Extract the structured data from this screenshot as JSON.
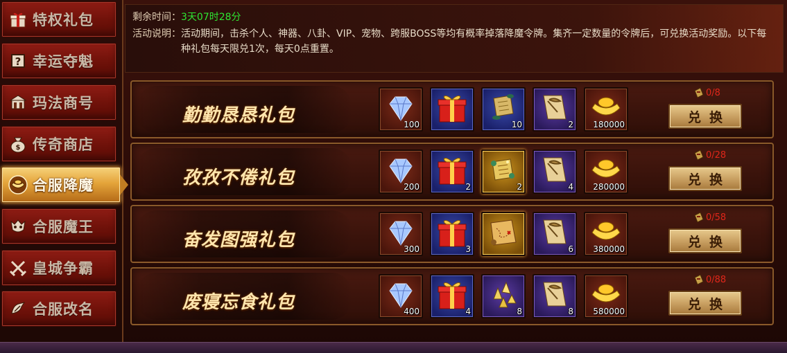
{
  "sidebar": {
    "items": [
      {
        "label": "特权礼包",
        "icon": "gift-box-icon"
      },
      {
        "label": "幸运夺魁",
        "icon": "question-mark-icon"
      },
      {
        "label": "玛法商号",
        "icon": "shop-icon"
      },
      {
        "label": "传奇商店",
        "icon": "money-bag-icon"
      },
      {
        "label": "合服降魔",
        "icon": "ingot-icon",
        "active": true
      },
      {
        "label": "合服魔王",
        "icon": "demon-skull-icon"
      },
      {
        "label": "皇城争霸",
        "icon": "crossed-swords-icon"
      },
      {
        "label": "合服改名",
        "icon": "rename-icon"
      }
    ]
  },
  "info": {
    "time_label": "剩余时间：",
    "time_value": "3天07时28分",
    "desc_label": "活动说明：",
    "desc_text": "活动期间，击杀个人、神器、八卦、VIP、宠物、跨服BOSS等均有概率掉落降魔令牌。集齐一定数量的令牌后，可兑换活动奖励。以下每种礼包每天限兑1次，每天0点重置。"
  },
  "gifts": [
    {
      "title": "勤勤恳恳礼包",
      "items": [
        {
          "icon": "diamond-icon",
          "count": "100"
        },
        {
          "icon": "red-gift-box-icon",
          "count": ""
        },
        {
          "icon": "scroll-icon",
          "count": "10"
        },
        {
          "icon": "pickaxe-scroll-icon",
          "count": "2"
        },
        {
          "icon": "gold-ingot-icon",
          "count": "180000"
        }
      ],
      "limit": "0/8",
      "button": "兑换"
    },
    {
      "title": "孜孜不倦礼包",
      "items": [
        {
          "icon": "diamond-icon",
          "count": "200"
        },
        {
          "icon": "red-gift-box-icon",
          "count": "2"
        },
        {
          "icon": "magic-scroll-icon",
          "count": "2"
        },
        {
          "icon": "pickaxe-scroll-icon",
          "count": "4"
        },
        {
          "icon": "gold-ingot-icon",
          "count": "280000"
        }
      ],
      "limit": "0/28",
      "button": "兑换"
    },
    {
      "title": "奋发图强礼包",
      "items": [
        {
          "icon": "diamond-icon",
          "count": "300"
        },
        {
          "icon": "red-gift-box-icon",
          "count": "3"
        },
        {
          "icon": "treasure-map-icon",
          "count": ""
        },
        {
          "icon": "pickaxe-scroll-icon",
          "count": "6"
        },
        {
          "icon": "gold-ingot-icon",
          "count": "380000"
        }
      ],
      "limit": "0/58",
      "button": "兑换"
    },
    {
      "title": "废寝忘食礼包",
      "items": [
        {
          "icon": "diamond-icon",
          "count": "400"
        },
        {
          "icon": "red-gift-box-icon",
          "count": "4"
        },
        {
          "icon": "gold-crystal-icon",
          "count": "8"
        },
        {
          "icon": "pickaxe-scroll-icon",
          "count": "8"
        },
        {
          "icon": "gold-ingot-icon",
          "count": "580000"
        }
      ],
      "limit": "0/88",
      "button": "兑换"
    }
  ]
}
